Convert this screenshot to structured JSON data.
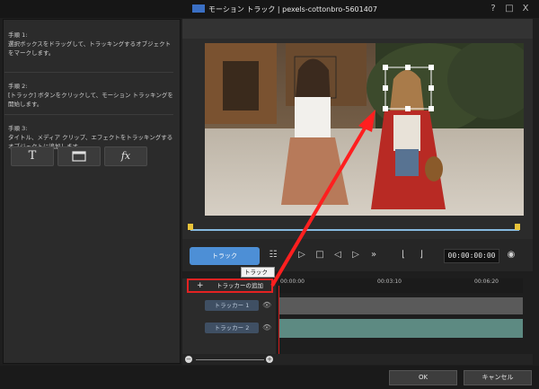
{
  "window": {
    "title": "モーション トラック | pexels-cottonbro-5601407",
    "help_label": "?",
    "restore_label": "□",
    "close_label": "X"
  },
  "steps": [
    {
      "label": "手順 1:",
      "text": "選択ボックスをドラッグして、トラッキングするオブジェクトをマークします。"
    },
    {
      "label": "手順 2:",
      "text": "[トラック] ボタンをクリックして、モーション トラッキングを開始します。"
    },
    {
      "label": "手順 3:",
      "text": "タイトル、メディア クリップ、エフェクトをトラッキングするオブジェクトに追加します。"
    }
  ],
  "tools": [
    {
      "icon": "title-icon",
      "glyph": "T"
    },
    {
      "icon": "media-icon",
      "glyph": ""
    },
    {
      "icon": "effect-icon",
      "glyph": "fx"
    }
  ],
  "player": {
    "track_label": "トラック",
    "timecode": "00:00:00:00",
    "tooltip": "トラック"
  },
  "timeline": {
    "add_tracker_label": "トラッカーの追加",
    "ticks": [
      "00:00:00",
      "00:03:10",
      "00:06:20"
    ],
    "trackers": [
      {
        "label": "トラッカー 1"
      },
      {
        "label": "トラッカー 2"
      }
    ]
  },
  "footer": {
    "ok_label": "OK",
    "cancel_label": "キャンセル"
  },
  "colors": {
    "accent": "#4d8fd6",
    "highlight_box": "#e32222",
    "arrow": "#ff1f1f",
    "scrubber": "#86b9df",
    "tracker_row": "#5d8a82"
  }
}
